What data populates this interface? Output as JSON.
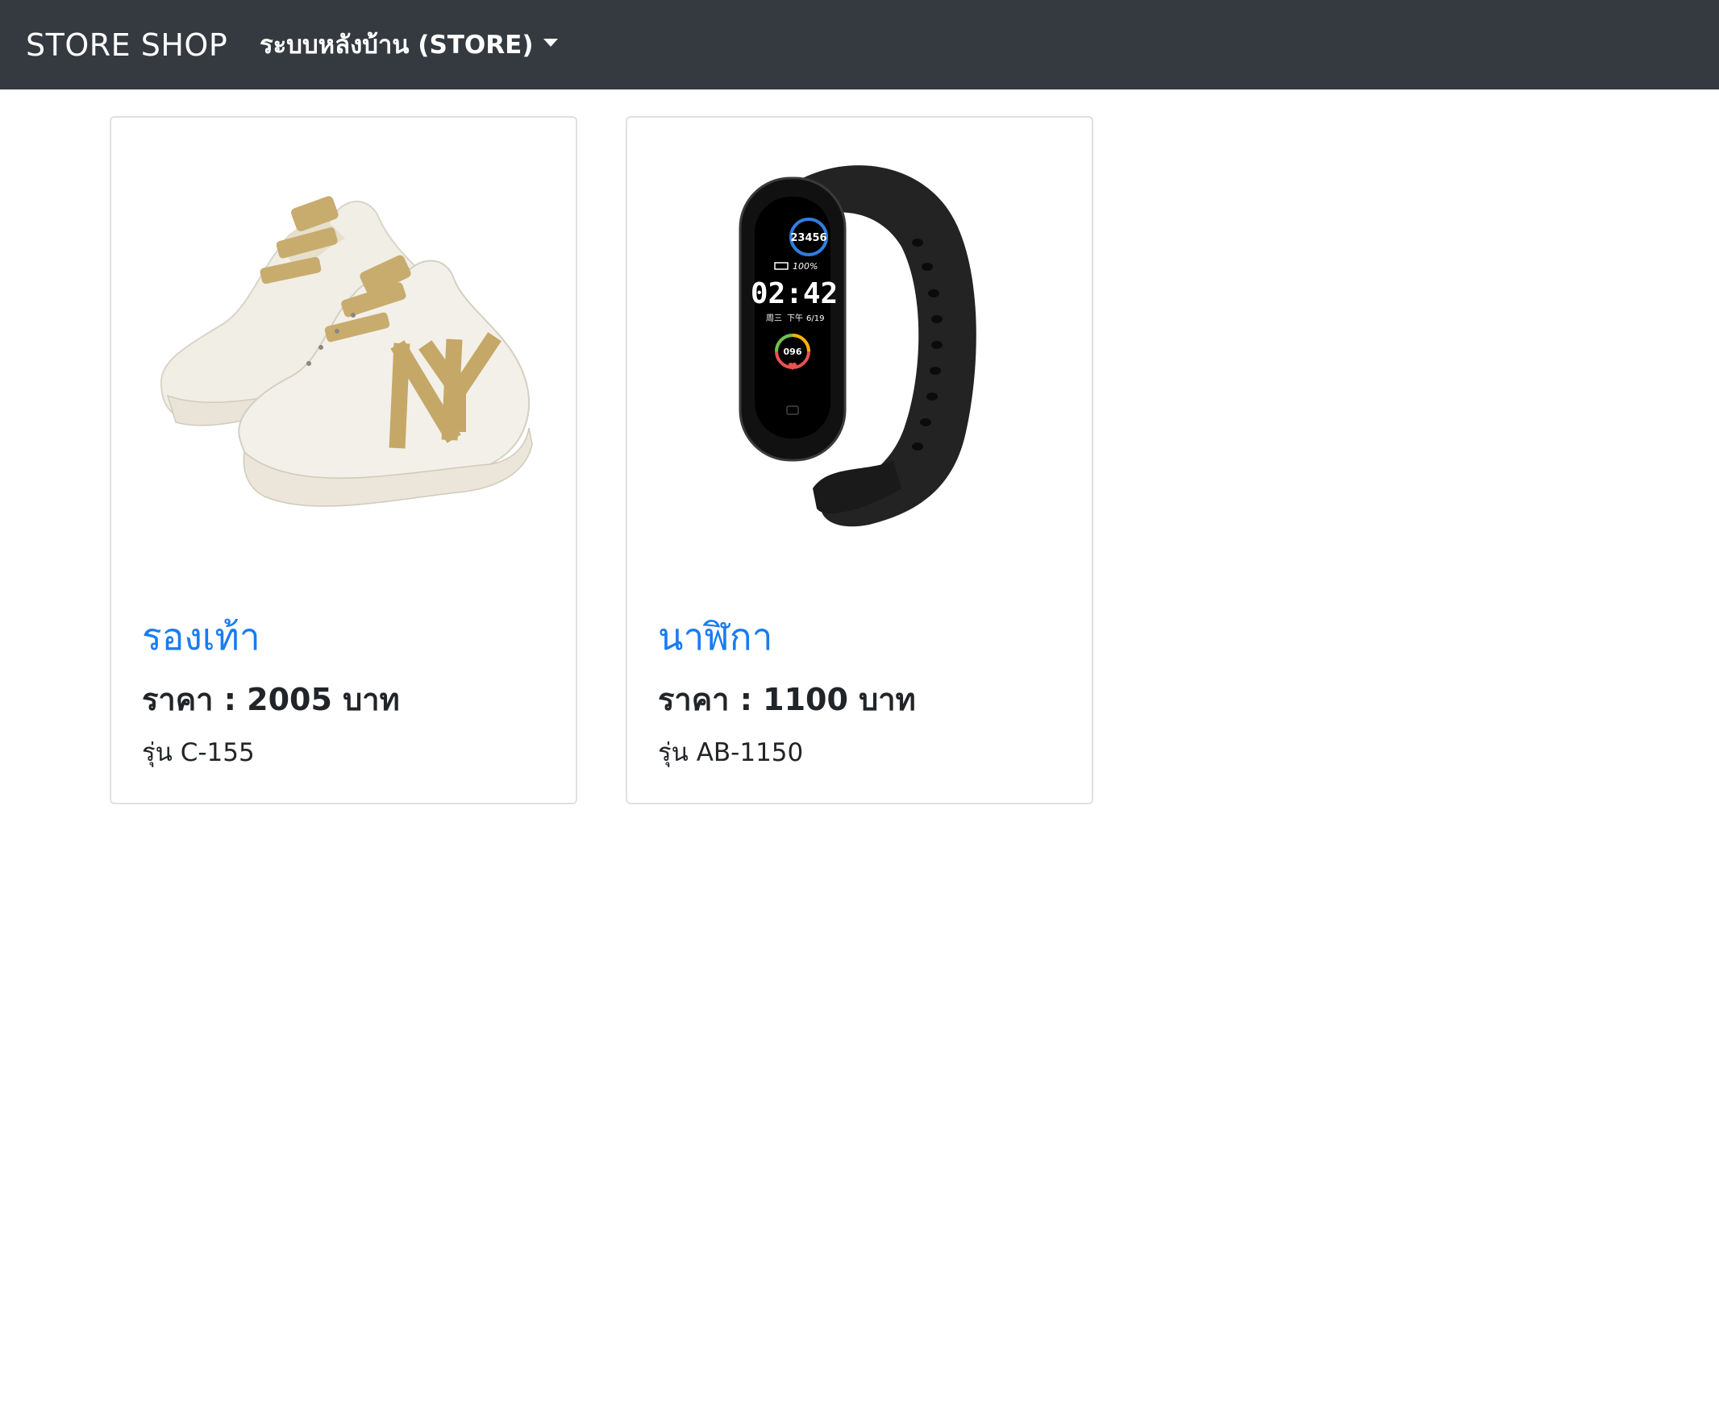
{
  "navbar": {
    "brand": "STORE SHOP",
    "dropdown_label": "ระบบหลังบ้าน (STORE)",
    "background": "#343a40"
  },
  "products": [
    {
      "name": "รองเท้า",
      "price": "ราคา : 2005 บาท",
      "model": "รุ่น C-155",
      "image": "sneakers-image"
    },
    {
      "name": "นาฬิกา",
      "price": "ราคา : 1100 บาท",
      "model": "รุ่น AB-1150",
      "image": "smart-band-image",
      "screen": {
        "steps": "23456",
        "battery": "100%",
        "time": "02:42",
        "day": "周三",
        "period": "下午",
        "date": "6/19",
        "heart_rate": "096"
      }
    }
  ],
  "colors": {
    "link": "#1a7cf0",
    "text": "#212529",
    "border": "#dfe0e1"
  }
}
